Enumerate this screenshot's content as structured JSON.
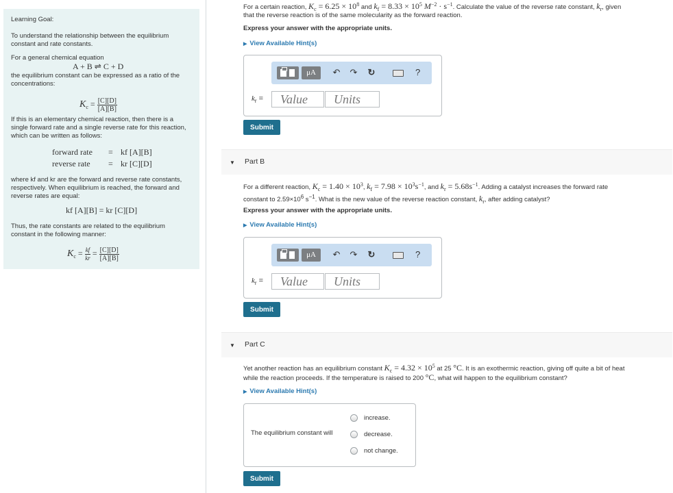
{
  "sidebar": {
    "title": "Learning Goal:",
    "intro": "To understand the relationship between the equilibrium constant and rate constants.",
    "general_label": "For a general chemical equation",
    "equation": "A + B ⇌ C + D",
    "ratio_text": "the equilibrium constant can be expressed as a ratio of the concentrations:",
    "kc_symbol": "K",
    "kc_sub": "c",
    "kc_num": "[C][D]",
    "kc_den": "[A][B]",
    "elementary_text": "If this is an elementary chemical reaction, then there is a single forward rate and a single reverse rate for this reaction, which can be written as follows:",
    "forward_rate_label": "forward rate",
    "forward_rate_expr": "kf [A][B]",
    "reverse_rate_label": "reverse rate",
    "reverse_rate_expr": "kr [C][D]",
    "where_text": "where kf and kr are the forward and reverse rate constants, respectively. When equilibrium is reached, the forward and reverse rates are equal:",
    "equal_rates_expr": "kf [A][B] = kr [C][D]",
    "thus_text": "Thus, the rate constants are related to the equilibrium constant in the following manner:",
    "relation_kf": "kf",
    "relation_kr": "kr",
    "relation_num": "[C][D]",
    "relation_den": "[A][B]"
  },
  "part_a": {
    "question_l1_pre": "For a certain reaction, ",
    "question_kc_val": "6.25 × 10",
    "question_kc_exp": "8",
    "question_and": " and ",
    "question_kf_val": "8.33 × 10",
    "question_kf_exp": "5",
    "question_units": "M",
    "question_units_exp": "−2",
    "question_units_s_exp": "−1",
    "question_l1_post": ". Calculate the value of the reverse rate constant, ",
    "question_l1_end": ", given",
    "question_l2": "that the reverse reaction is of the same molecularity as the forward reaction.",
    "express": "Express your answer with the appropriate units.",
    "hint": "View Available Hint(s)",
    "k_label": "k",
    "k_sub": "r",
    "k_eq": " =",
    "value_placeholder": "Value",
    "units_placeholder": "Units",
    "submit": "Submit"
  },
  "part_b": {
    "title": "Part B",
    "q_pre": "For a different reaction, ",
    "q_kc": "1.40 × 10",
    "q_kc_exp": "3",
    "q_kf": "7.98 × 10",
    "q_kf_exp": "3",
    "q_kf_unit": "s",
    "q_kf_unit_exp": "−1",
    "q_and": ", and ",
    "q_kr": "5.68",
    "q_kr_unit": "s",
    "q_kr_unit_exp": "−1",
    "q_post": ". Adding a catalyst increases the forward rate",
    "q_l2_pre": "constant to 2.59×10",
    "q_l2_exp": "6",
    "q_l2_unit": " s",
    "q_l2_unit_exp": "−1",
    "q_l2_post": ". What is the new value of the reverse reaction constant, ",
    "q_l2_end": ", after adding catalyst?",
    "express": "Express your answer with the appropriate units.",
    "hint": "View Available Hint(s)",
    "k_label": "k",
    "k_sub": "r",
    "k_eq": " =",
    "value_placeholder": "Value",
    "units_placeholder": "Units",
    "submit": "Submit"
  },
  "part_c": {
    "title": "Part C",
    "q_pre": "Yet another reaction has an equilibrium constant ",
    "q_kc": "4.32 × 10",
    "q_kc_exp": "5",
    "q_at": " at 25 ",
    "q_deg": "°C",
    "q_post": ". It is an exothermic reaction, giving off quite a bit of heat",
    "q_l2_pre": "while the reaction proceeds. If the temperature is raised to 200 ",
    "q_l2_deg": "°C",
    "q_l2_post": ", what will happen to the equilibrium constant?",
    "hint": "View Available Hint(s)",
    "stem": "The equilibrium constant will",
    "options": [
      "increase.",
      "decrease.",
      "not change."
    ],
    "submit": "Submit"
  },
  "toolbar": {
    "mu_label": "μA",
    "undo": "↶",
    "redo": "↷",
    "reset": "↻",
    "help": "?"
  },
  "colors": {
    "sidebar_bg": "#e8f3f3",
    "link": "#2c7ab0",
    "submit_bg": "#1f6f8e",
    "toolbar_bg": "#c9ddf1"
  }
}
